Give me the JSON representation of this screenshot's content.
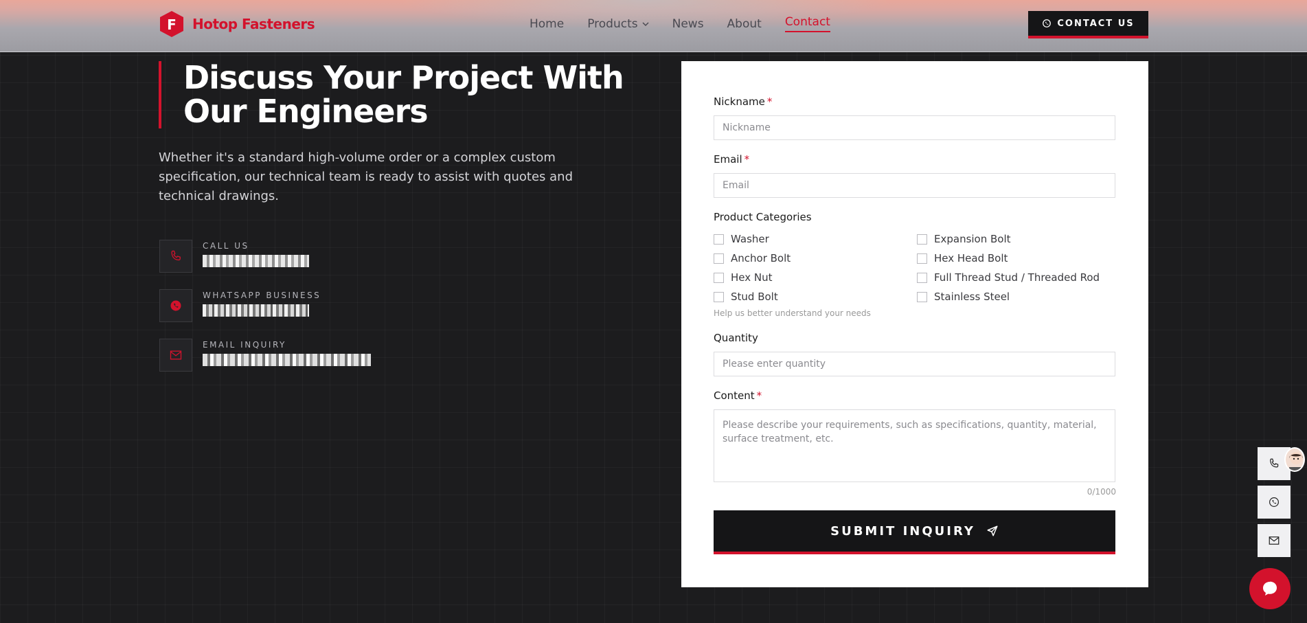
{
  "brand": {
    "name": "Hotop Fasteners",
    "logo_letter": "F",
    "accent_color": "#d3122c"
  },
  "nav": {
    "items": [
      {
        "label": "Home"
      },
      {
        "label": "Products"
      },
      {
        "label": "News"
      },
      {
        "label": "About"
      },
      {
        "label": "Contact"
      }
    ],
    "active": "Contact"
  },
  "header": {
    "contact_button": "CONTACT US"
  },
  "hero": {
    "title": "Discuss Your Project With Our Engineers",
    "intro": "Whether it's a standard high-volume order or a complex custom specification, our technical team is ready to assist with quotes and technical drawings."
  },
  "contacts": [
    {
      "label": "CALL US",
      "icon": "phone-icon"
    },
    {
      "label": "WHATSAPP BUSINESS",
      "icon": "whatsapp-icon"
    },
    {
      "label": "EMAIL INQUIRY",
      "icon": "mail-icon"
    }
  ],
  "form": {
    "nickname": {
      "label": "Nickname",
      "required": "*",
      "placeholder": "Nickname"
    },
    "email": {
      "label": "Email",
      "required": "*",
      "placeholder": "Email"
    },
    "categories": {
      "label": "Product Categories",
      "options": [
        "Washer",
        "Expansion Bolt",
        "Anchor Bolt",
        "Hex Head Bolt",
        "Hex Nut",
        "Full Thread Stud / Threaded Rod",
        "Stud Bolt",
        "Stainless Steel"
      ],
      "hint": "Help us better understand your needs"
    },
    "quantity": {
      "label": "Quantity",
      "placeholder": "Please enter quantity"
    },
    "content": {
      "label": "Content",
      "required": "*",
      "placeholder": "Please describe your requirements, such as specifications, quantity, material, surface treatment, etc.",
      "counter": "0/1000"
    },
    "submit": "SUBMIT INQUIRY"
  }
}
